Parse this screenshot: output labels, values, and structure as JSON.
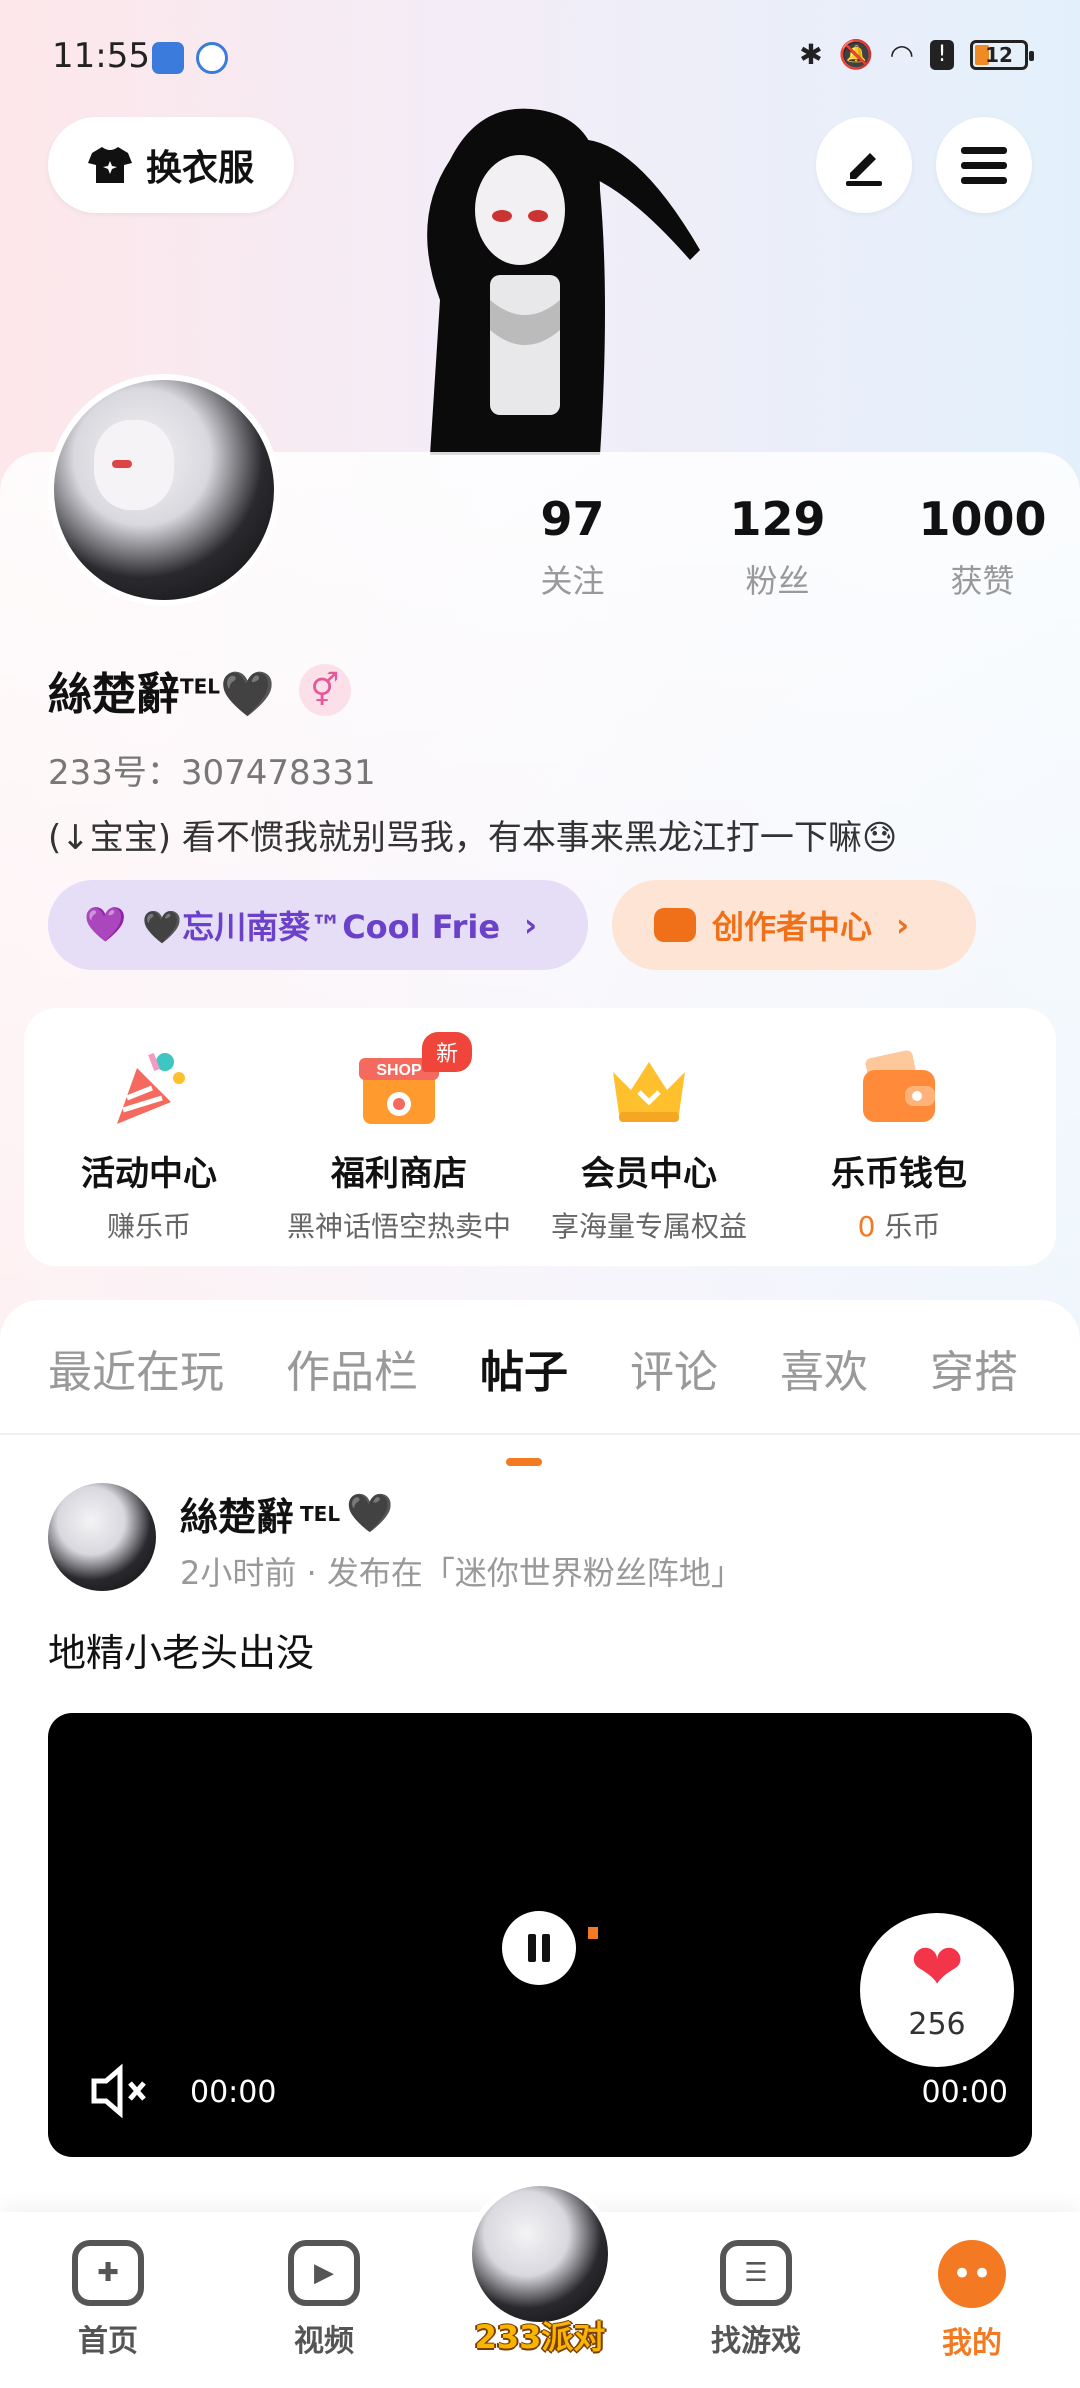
{
  "status_bar": {
    "time": "11:55",
    "battery": "12"
  },
  "top_bar": {
    "outfit_label": "换衣服"
  },
  "profile": {
    "stats": [
      {
        "num": "97",
        "label": "关注"
      },
      {
        "num": "129",
        "label": "粉丝"
      },
      {
        "num": "1000",
        "label": "获赞"
      }
    ],
    "name": "絲楚辭",
    "name_sup": "TEL",
    "name_heart": "🖤",
    "gender_symbol": "⚥",
    "uid": "233号：307478331",
    "bio": "(↓宝宝) 看不惯我就别骂我，有本事来黑龙江打一下嘛😓",
    "friend_pill": "🖤忘川南葵™Cool Frie",
    "creator_pill": "创作者中心"
  },
  "features": [
    {
      "title": "活动中心",
      "sub": "赚乐币",
      "color": "#f56a5e"
    },
    {
      "title": "福利商店",
      "sub": "黑神话悟空热卖中",
      "color": "#ff9a2e",
      "badge": "新"
    },
    {
      "title": "会员中心",
      "sub": "享海量专属权益",
      "color": "#ffc02e"
    },
    {
      "title": "乐币钱包",
      "sub_num": "0",
      "sub": "乐币",
      "color": "#ff8a3a"
    }
  ],
  "tabs": [
    "最近在玩",
    "作品栏",
    "帖子",
    "评论",
    "喜欢",
    "穿搭"
  ],
  "active_tab": "帖子",
  "post": {
    "author": "絲楚辭",
    "author_sup": "TEL",
    "author_heart": "🖤",
    "meta": "2小时前 · 发布在「迷你世界粉丝阵地」",
    "text": "地精小老头出没",
    "video": {
      "time_left": "00:00",
      "time_right": "00:00",
      "likes": "256"
    }
  },
  "nav": {
    "items": [
      {
        "label": "首页",
        "icon": "gamepad-icon"
      },
      {
        "label": "视频",
        "icon": "play-icon"
      },
      {
        "label": "233派对",
        "icon": "avatar"
      },
      {
        "label": "找游戏",
        "icon": "list-icon"
      },
      {
        "label": "我的",
        "icon": "profile-icon"
      }
    ],
    "accent": "#f37a22"
  }
}
